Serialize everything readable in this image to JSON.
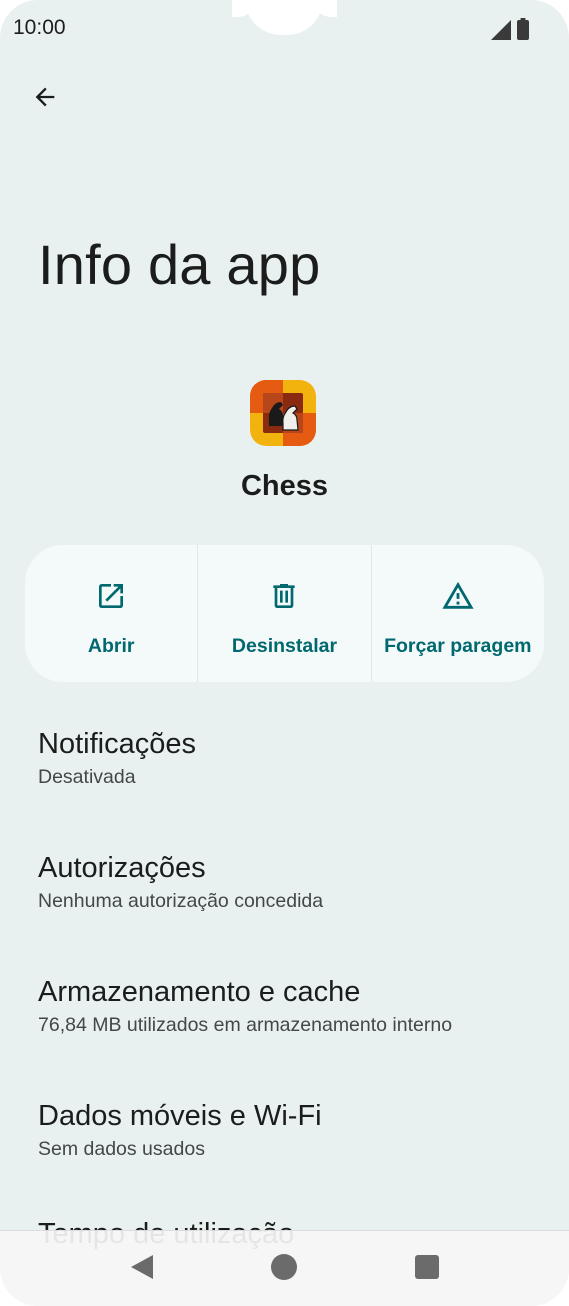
{
  "status_bar": {
    "time": "10:00",
    "icons": [
      "signal-icon",
      "battery-icon"
    ]
  },
  "header": {
    "back_icon": "arrow-back-icon",
    "title": "Info da app"
  },
  "app": {
    "name": "Chess",
    "icon": "chess-app-icon"
  },
  "actions": [
    {
      "label": "Abrir",
      "icon": "open-external-icon"
    },
    {
      "label": "Desinstalar",
      "icon": "trash-icon"
    },
    {
      "label": "Forçar paragem",
      "icon": "warning-icon"
    }
  ],
  "settings": [
    {
      "title": "Notificações",
      "subtitle": "Desativada"
    },
    {
      "title": "Autorizações",
      "subtitle": "Nenhuma autorização concedida"
    },
    {
      "title": "Armazenamento e cache",
      "subtitle": "76,84 MB utilizados em armazenamento interno"
    },
    {
      "title": "Dados móveis e Wi-Fi",
      "subtitle": "Sem dados usados"
    },
    {
      "title": "Tempo de utilização",
      "subtitle": ""
    }
  ],
  "nav_bar": {
    "back": "nav-back-icon",
    "home": "nav-home-icon",
    "recents": "nav-recents-icon"
  },
  "colors": {
    "background": "#e9f1f0",
    "accent": "#00696f",
    "card": "#f4f9f9",
    "text_primary": "#1b1c1c",
    "text_secondary": "#42484a"
  }
}
